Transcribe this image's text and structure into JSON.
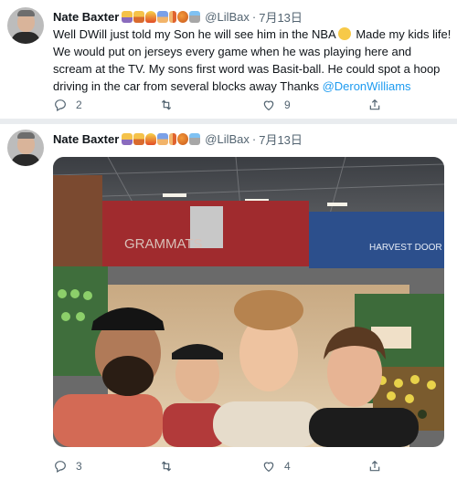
{
  "tweets": [
    {
      "author": {
        "name": "Nate Baxter",
        "handle": "@LilBax"
      },
      "header_emojis": [
        "family-emoji",
        "couple-emoji",
        "fire-emoji",
        "deaf-person-emoji",
        "runner-emoji",
        "basketball-emoji",
        "cityscape-emoji"
      ],
      "date": "7月13日",
      "text_part1": "Well DWill just told my Son he will see him in the NBA",
      "text_part2": " Made my kids life! We would put on jerseys every game when he was playing here and scream at the TV. My sons first word was Basit-ball. He could spot a hoop driving in the car from several blocks away Thanks ",
      "mention": "@DeronWilliams",
      "inline_emoji": "relieved-face-emoji",
      "actions": {
        "replies": "2",
        "retweets": "",
        "likes": "9"
      }
    },
    {
      "author": {
        "name": "Nate Baxter",
        "handle": "@LilBax"
      },
      "header_emojis": [
        "family-emoji",
        "couple-emoji",
        "fire-emoji",
        "deaf-person-emoji",
        "runner-emoji",
        "basketball-emoji",
        "cityscape-emoji"
      ],
      "date": "7月13日",
      "photo": {
        "description_icon": "selfie-photo",
        "store_sign": "GRAMMATS",
        "aisle_sign": "HARVEST DOOR"
      },
      "actions": {
        "replies": "3",
        "retweets": "",
        "likes": "4"
      }
    }
  ],
  "ui": {
    "dot": "·",
    "colors": {
      "link": "#1d9bf0",
      "secondary_text": "#536471",
      "page_bg": "#e9ecef"
    }
  }
}
